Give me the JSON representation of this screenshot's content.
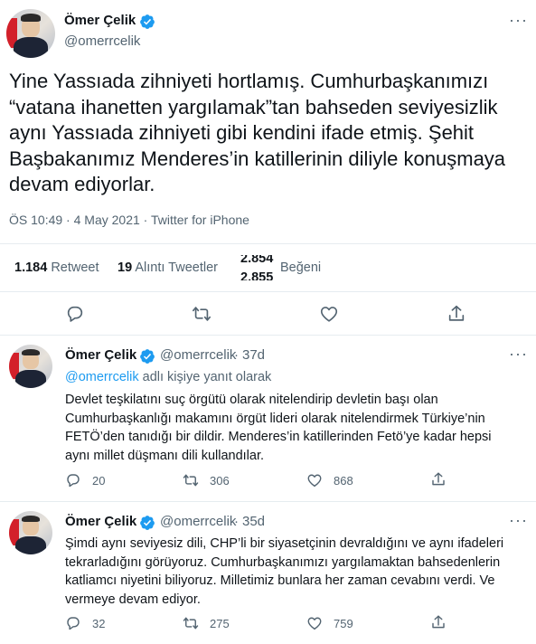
{
  "main_tweet": {
    "author_name": "Ömer Çelik",
    "author_handle": "@omerrcelik",
    "text": "Yine Yassıada zihniyeti hortlamış. Cumhurbaşkanımızı “vatana ihanetten yargılamak”tan bahseden seviyesizlik aynı Yassıada zihniyeti gibi kendini ifade etmiş. Şehit Başbakanımız Menderes’in katillerinin diliyle konuşmaya devam ediyorlar.",
    "time": "ÖS 10:49",
    "date": "4 May 2021",
    "source": "Twitter for iPhone",
    "retweets_count": "1.184",
    "retweets_label": "Retweet",
    "quotes_count": "19",
    "quotes_label": "Alıntı Tweetler",
    "likes_count_top": "2.854",
    "likes_count_bottom": "2.855",
    "likes_label": "Beğeni"
  },
  "replies": [
    {
      "author_name": "Ömer Çelik",
      "author_handle": "@omerrcelik",
      "time_ago": "37d",
      "replying_mention": "@omerrcelik",
      "replying_suffix": "adlı kişiye yanıt olarak",
      "text": "Devlet teşkilatını suç örgütü olarak nitelendirip devletin başı olan Cumhurbaşkanlığı makamını örgüt lideri olarak nitelendirmek Türkiye’nin FETÖ’den tanıdığı bir dildir. Menderes’in katillerinden Fetö’ye kadar hepsi aynı millet düşmanı dili kullandılar.",
      "reply_count": "20",
      "retweet_count": "306",
      "like_count": "868"
    },
    {
      "author_name": "Ömer Çelik",
      "author_handle": "@omerrcelik",
      "time_ago": "35d",
      "text": "Şimdi aynı seviyesiz dili, CHP’li bir siyasetçinin devraldığını ve aynı ifadeleri tekrarladığını görüyoruz. Cumhurbaşkanımızı yargılamaktan bahsedenlerin katliamcı niyetini biliyoruz. Milletimiz bunlara her zaman cevabını verdi. Ve vermeye devam ediyor.",
      "reply_count": "32",
      "retweet_count": "275",
      "like_count": "759"
    }
  ],
  "icons": {
    "verified": "verified-badge-icon",
    "reply": "reply-icon",
    "retweet": "retweet-icon",
    "like": "like-icon",
    "share": "share-icon",
    "more": "more-icon"
  },
  "colors": {
    "accent": "#1d9bf0",
    "text": "#0f1419",
    "secondary": "#536471",
    "divider": "#e6ecf0"
  },
  "more_glyph": "···",
  "separator": "·"
}
